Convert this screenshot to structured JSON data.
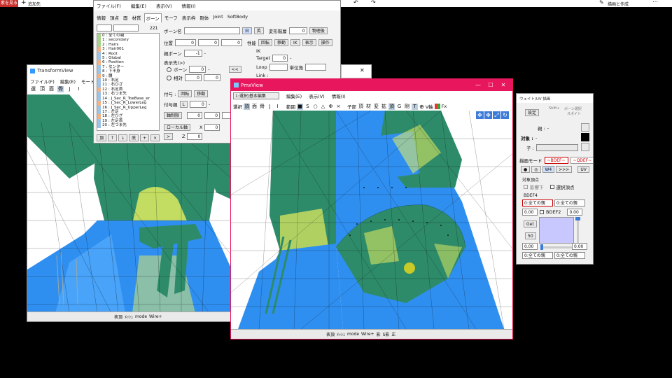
{
  "top_bar": {
    "left_badge": "素を見る",
    "add_label": "追加先",
    "right_label": "描画と作成"
  },
  "main_window": {
    "menu": [
      "ファイル(F)",
      "編集(E)",
      "表示(V)",
      "情報(I)"
    ],
    "tabs": [
      "情報",
      "頂点",
      "面",
      "材質",
      "ボーン",
      "モーフ",
      "表示枠",
      "剛体",
      "Joint",
      "SoftBody"
    ],
    "active_tab": "ボーン",
    "bone_count": "221",
    "bone_list": [
      "0 : 全ての親",
      "1 : secondary",
      "2 : Hairs",
      "3 : Hair001",
      "4 : Root",
      "5 : Global",
      "6 : Position",
      "7 : センター",
      "8 : 下半身",
      "9 : 腰",
      "10 : 右足",
      "11 : 右ひざ",
      "12 : 右足首",
      "13 : 右つま先",
      "14 : J_Sec_R_ToeBase_er",
      "15 : J_Sec_R_LowerLeg",
      "16 : J_Sec_R_UpperLeg",
      "17 : 左足",
      "18 : 左ひざ",
      "19 : 左足首",
      "20 : 左つま先"
    ],
    "list_buttons": [
      "頂",
      "↑",
      "↓",
      "底",
      "+",
      "×"
    ],
    "bone_name_label": "ボーン名",
    "bone_name_btns": [
      "日",
      "英"
    ],
    "deform_label": "変形階層",
    "deform_value": "0",
    "physics_btn": "物理後",
    "pos_label": "位置",
    "pos_values": [
      "0",
      "0",
      "0"
    ],
    "perf_label": "性能",
    "perf_btns": [
      "回転",
      "移動",
      "IK",
      "表示",
      "操作"
    ],
    "parent_label": "親ボーン",
    "parent_value": "-1",
    "ik_label": "IK",
    "target_label": "Target",
    "target_value": "0",
    "loop_label": "Loop",
    "unit_label": "単位角",
    "link_label": "Link :",
    "display_label": "表示先(>)",
    "radio_bone": "ボーン",
    "radio_relative": "相対",
    "disp_val1": "0",
    "disp_val2": "0",
    "disp_val3": "0",
    "collapse_btn": "<<",
    "grant_label": "付与 :",
    "grant_btns": [
      "回転",
      "移動"
    ],
    "grant_parent_label": "付与親",
    "grant_L": "L",
    "grant_parent_value": "0",
    "axis_fix_btn": "軸制限",
    "axis_values": [
      "0",
      "0",
      "0"
    ],
    "local_btn": "ローカル軸",
    "x_label": "X",
    "z_label": "Z",
    "x_value": "0",
    "z_value": "0"
  },
  "transform_view": {
    "title": "TransformView",
    "menu": [
      "ファイル(F)",
      "編集(E)",
      "モード"
    ],
    "toolbar": [
      "選",
      "頂",
      "面",
      "骨",
      "J",
      "I"
    ],
    "status_items": [
      "表頂",
      "ﾒｯｼｭ",
      "mode",
      "Wire+"
    ]
  },
  "pmx_view": {
    "title": "PmxView",
    "mode_select": "1:選択/基本編集",
    "menu": [
      "編集(E)",
      "表示(V)",
      "情報(I)"
    ],
    "toolbar_left": [
      "選択",
      "頂",
      "面",
      "骨",
      "J",
      "I"
    ],
    "toolbar_mid": [
      "範囲",
      "■",
      "S",
      "○",
      "△",
      "Φ",
      "×"
    ],
    "toolbar_right": [
      "子部",
      "頂",
      "材",
      "変",
      "拡",
      "頂",
      "G",
      "剛",
      "T",
      "V軸",
      "Fx"
    ],
    "status_items": [
      "表頂",
      "ﾒｯｼｭ",
      "mode",
      "Wire+",
      "影",
      "S影",
      "正"
    ]
  },
  "weight_panel": {
    "title": "ウェイト/UV 描画",
    "btn_shift": "Shift+",
    "btn_bone": "ボーン選択",
    "btn_spoid": "スポイト",
    "btn_setting": "設定",
    "parent_label": "親 :",
    "parent_value": "-",
    "target_label": "対象 :",
    "target_value": "-",
    "child_label": "子 :",
    "draw_mode_label": "描画モード",
    "bdef_btn": "~BDEF~",
    "qdef_btn": "~QDEF~",
    "w4": "W4",
    "arrow_btn": ">>>",
    "uv_btn": "UV",
    "target_vertex_label": "対象頂点",
    "cb_hide": "影響下",
    "cb_select": "選択頂点",
    "bdef4_label": "BDEF4",
    "bone_select_1": "0:全ての親",
    "bone_select_2": "0:全ての親",
    "weight_1": "0.00",
    "weight_2": "0.00",
    "bdef2_label": "BDEF2",
    "get_btn": "Get",
    "rev_btn": "50",
    "weight_3": "0.00",
    "weight_4": "0.00",
    "bone_select_3": "0:全ての親",
    "bone_select_4": "0:全ての親",
    "swatch_color": "#c8c8ff"
  },
  "colors": {
    "pmx_title": "#e8175d",
    "mesh_blue": "#2f8ff0",
    "mesh_green": "#2e8b6a",
    "mesh_yellow": "#e8f060"
  }
}
